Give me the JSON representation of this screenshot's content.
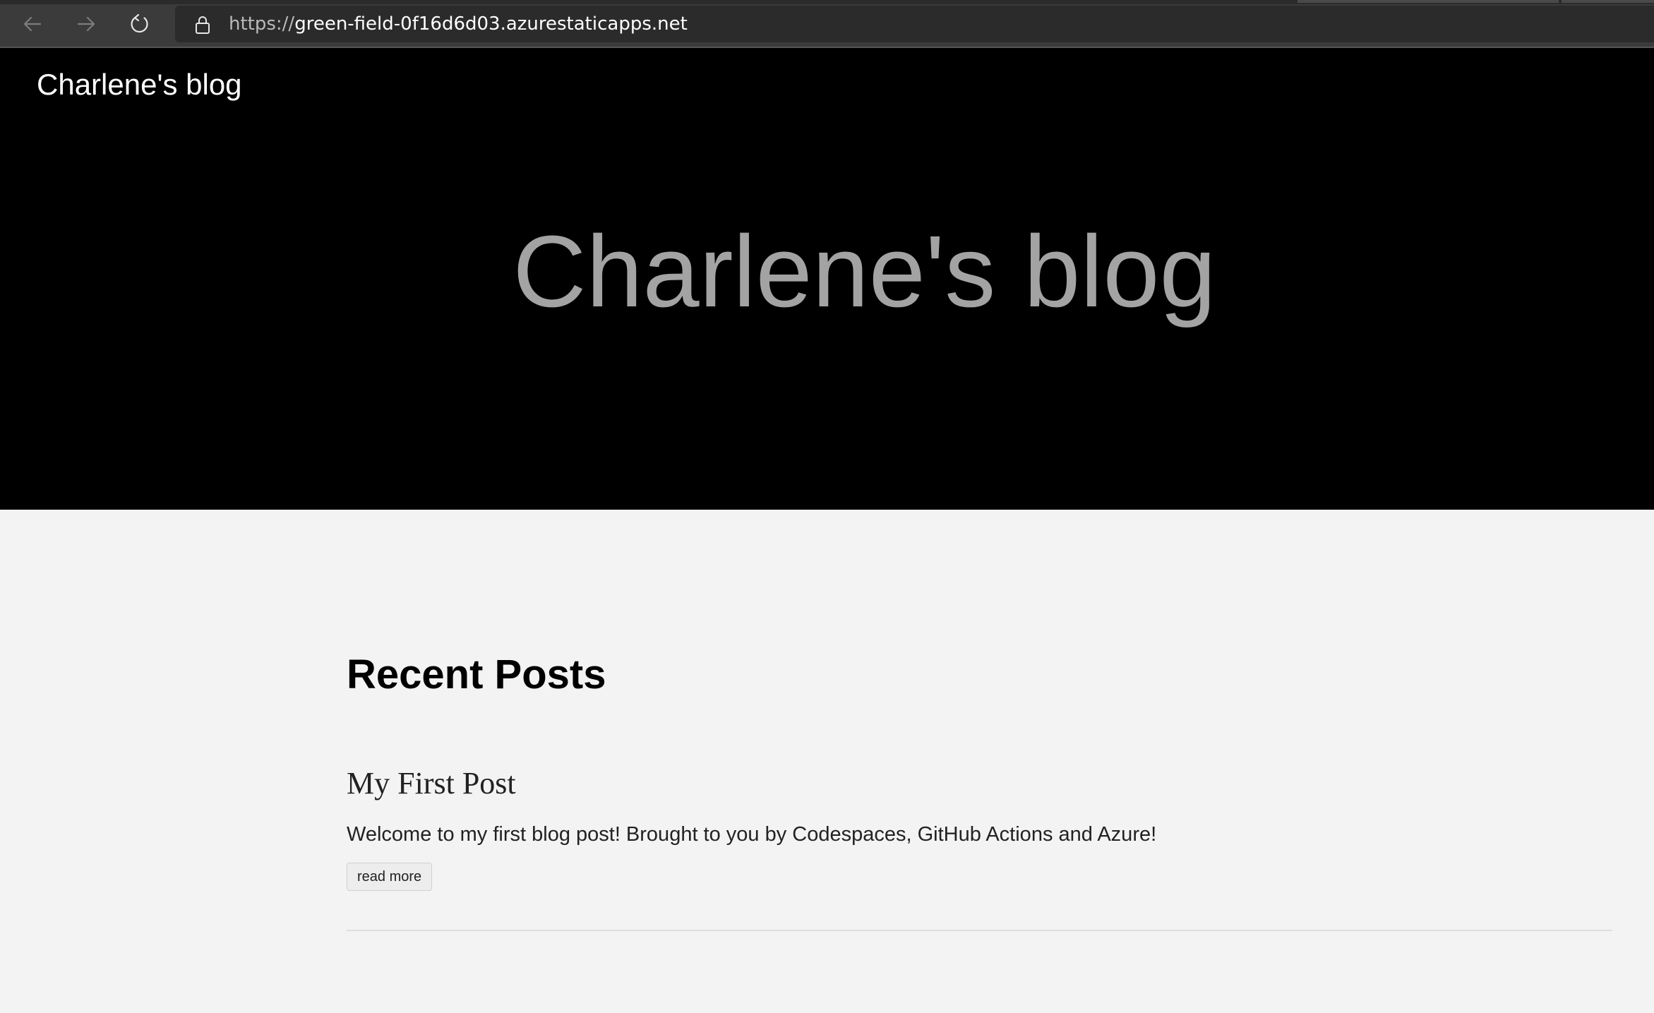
{
  "browser": {
    "url_scheme": "https://",
    "url_rest": "green-field-0f16d6d03.azurestaticapps.net",
    "icons": {
      "back": "arrow-left-icon",
      "forward": "arrow-right-icon",
      "reload": "reload-icon",
      "lock": "lock-icon"
    }
  },
  "header": {
    "site_title": "Charlene's blog"
  },
  "hero": {
    "title": "Charlene's blog"
  },
  "main": {
    "section_heading": "Recent Posts",
    "posts": [
      {
        "title": "My First Post",
        "excerpt": "Welcome to my first blog post! Brought to you by Codespaces, GitHub Actions and Azure!",
        "button_label": "read more"
      }
    ]
  },
  "colors": {
    "hero_background": "#000000",
    "hero_title": "#a3a3a3",
    "page_background": "#f3f3f3",
    "chrome_background": "#3b3b3b"
  }
}
